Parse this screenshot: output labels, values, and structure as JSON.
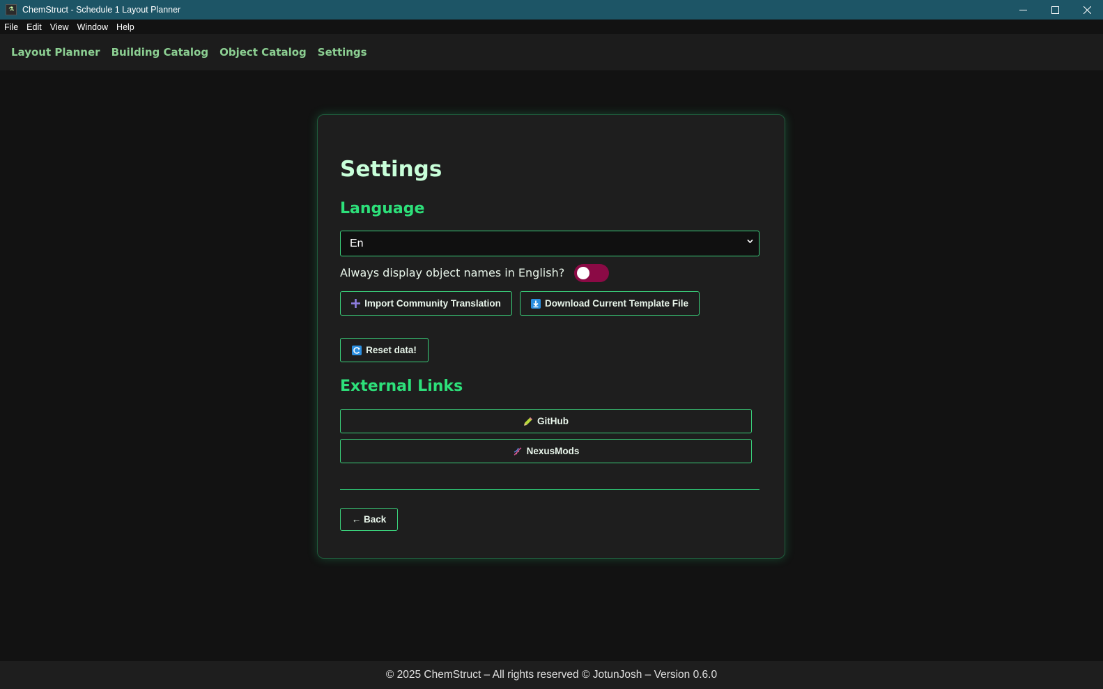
{
  "window": {
    "title": "ChemStruct - Schedule 1 Layout Planner",
    "controls": {
      "minimize": "—",
      "maximize": "☐",
      "close": "✕"
    }
  },
  "menubar": {
    "items": [
      "File",
      "Edit",
      "View",
      "Window",
      "Help"
    ]
  },
  "topnav": {
    "items": [
      "Layout Planner",
      "Building Catalog",
      "Object Catalog",
      "Settings"
    ]
  },
  "settings": {
    "title": "Settings",
    "language_heading": "Language",
    "language_value": "En",
    "english_names_label": "Always display object names in English?",
    "english_names_enabled": false,
    "import_label": "Import Community Translation",
    "download_label": "Download Current Template File",
    "reset_label": "Reset data!",
    "external_heading": "External Links",
    "github_label": "GitHub",
    "nexus_label": "NexusMods",
    "back_label": "← Back"
  },
  "footer": {
    "text": "© 2025 ChemStruct – All rights reserved © JotunJosh – Version 0.6.0"
  },
  "icons": {
    "app": "chemstruct-app-icon",
    "import": "plus-icon",
    "download": "download-arrow-icon",
    "reset": "refresh-icon",
    "github": "pencil-icon",
    "nexus": "dna-icon",
    "select": "chevron-down-icon"
  },
  "colors": {
    "titlebar": "#1d5566",
    "nav_link": "#8ccf92",
    "accent": "#3ad17b",
    "heading": "#2de07a",
    "toggle_off": "#8b0a45"
  }
}
